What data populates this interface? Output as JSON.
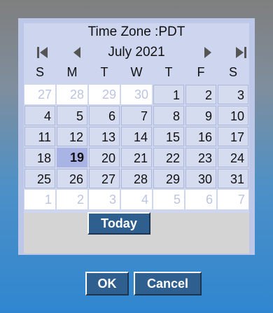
{
  "header": {
    "timezone_label": "Time Zone :PDT",
    "month_label": "July 2021"
  },
  "nav": {
    "first_icon": "skip-to-start-icon",
    "prev_icon": "chevron-left-icon",
    "next_icon": "chevron-right-icon",
    "last_icon": "skip-to-end-icon"
  },
  "weekdays": [
    "S",
    "M",
    "T",
    "W",
    "T",
    "F",
    "S"
  ],
  "weeks": [
    [
      {
        "d": "27",
        "t": "other"
      },
      {
        "d": "28",
        "t": "other"
      },
      {
        "d": "29",
        "t": "other"
      },
      {
        "d": "30",
        "t": "other"
      },
      {
        "d": "1",
        "t": "cur"
      },
      {
        "d": "2",
        "t": "cur"
      },
      {
        "d": "3",
        "t": "cur"
      }
    ],
    [
      {
        "d": "4",
        "t": "cur"
      },
      {
        "d": "5",
        "t": "cur"
      },
      {
        "d": "6",
        "t": "cur"
      },
      {
        "d": "7",
        "t": "cur"
      },
      {
        "d": "8",
        "t": "cur"
      },
      {
        "d": "9",
        "t": "cur"
      },
      {
        "d": "10",
        "t": "cur"
      }
    ],
    [
      {
        "d": "11",
        "t": "cur"
      },
      {
        "d": "12",
        "t": "cur"
      },
      {
        "d": "13",
        "t": "cur"
      },
      {
        "d": "14",
        "t": "cur"
      },
      {
        "d": "15",
        "t": "cur"
      },
      {
        "d": "16",
        "t": "cur"
      },
      {
        "d": "17",
        "t": "cur"
      }
    ],
    [
      {
        "d": "18",
        "t": "cur"
      },
      {
        "d": "19",
        "t": "sel"
      },
      {
        "d": "20",
        "t": "cur"
      },
      {
        "d": "21",
        "t": "cur"
      },
      {
        "d": "22",
        "t": "cur"
      },
      {
        "d": "23",
        "t": "cur"
      },
      {
        "d": "24",
        "t": "cur"
      }
    ],
    [
      {
        "d": "25",
        "t": "cur"
      },
      {
        "d": "26",
        "t": "cur"
      },
      {
        "d": "27",
        "t": "cur"
      },
      {
        "d": "28",
        "t": "cur"
      },
      {
        "d": "29",
        "t": "cur"
      },
      {
        "d": "30",
        "t": "cur"
      },
      {
        "d": "31",
        "t": "cur"
      }
    ],
    [
      {
        "d": "1",
        "t": "other"
      },
      {
        "d": "2",
        "t": "other"
      },
      {
        "d": "3",
        "t": "other"
      },
      {
        "d": "4",
        "t": "other"
      },
      {
        "d": "5",
        "t": "other"
      },
      {
        "d": "6",
        "t": "other"
      },
      {
        "d": "7",
        "t": "other"
      }
    ]
  ],
  "buttons": {
    "today_label": "Today",
    "ok_label": "OK",
    "cancel_label": "Cancel"
  },
  "colors": {
    "selected": "#aab4e4",
    "button": "#2f5f8f",
    "panel": "#cdd6ee"
  }
}
